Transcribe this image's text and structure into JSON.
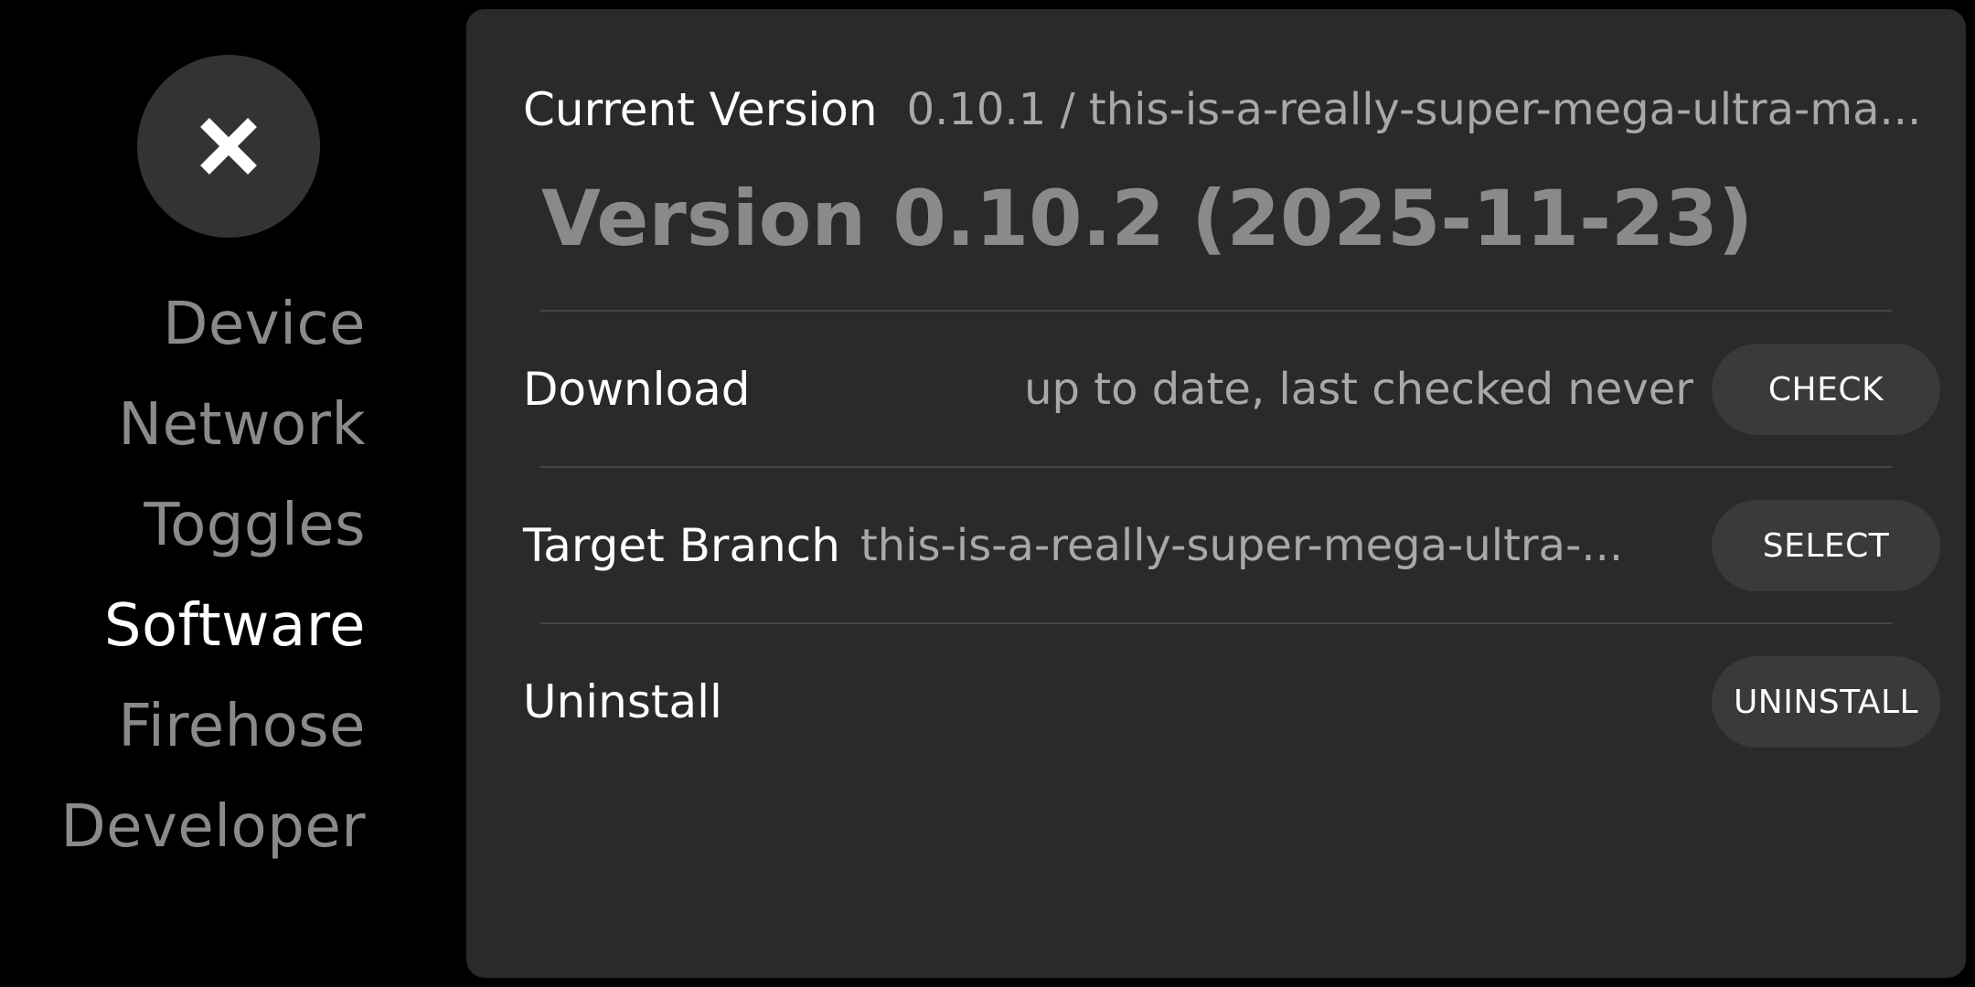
{
  "close": {
    "icon": "close-icon"
  },
  "sidebar": {
    "items": [
      {
        "label": "Device",
        "active": false
      },
      {
        "label": "Network",
        "active": false
      },
      {
        "label": "Toggles",
        "active": false
      },
      {
        "label": "Software",
        "active": true
      },
      {
        "label": "Firehose",
        "active": false
      },
      {
        "label": "Developer",
        "active": false
      }
    ]
  },
  "software": {
    "current_version_label": "Current Version",
    "current_version_value": "0.10.1 / this-is-a-really-super-mega-ultra-ma...",
    "release_title": "Version 0.10.2 (2025-11-23)",
    "download_label": "Download",
    "download_status": "up to date, last checked never",
    "check_button": "CHECK",
    "target_branch_label": "Target Branch",
    "target_branch_value": "this-is-a-really-super-mega-ultra-...",
    "select_button": "SELECT",
    "uninstall_label": "Uninstall",
    "uninstall_button": "UNINSTALL"
  },
  "colors": {
    "background": "#000000",
    "panel": "#2a2a2a",
    "button": "#3a3a3a",
    "active_text": "#ffffff",
    "inactive_text": "#8a8a8a"
  }
}
